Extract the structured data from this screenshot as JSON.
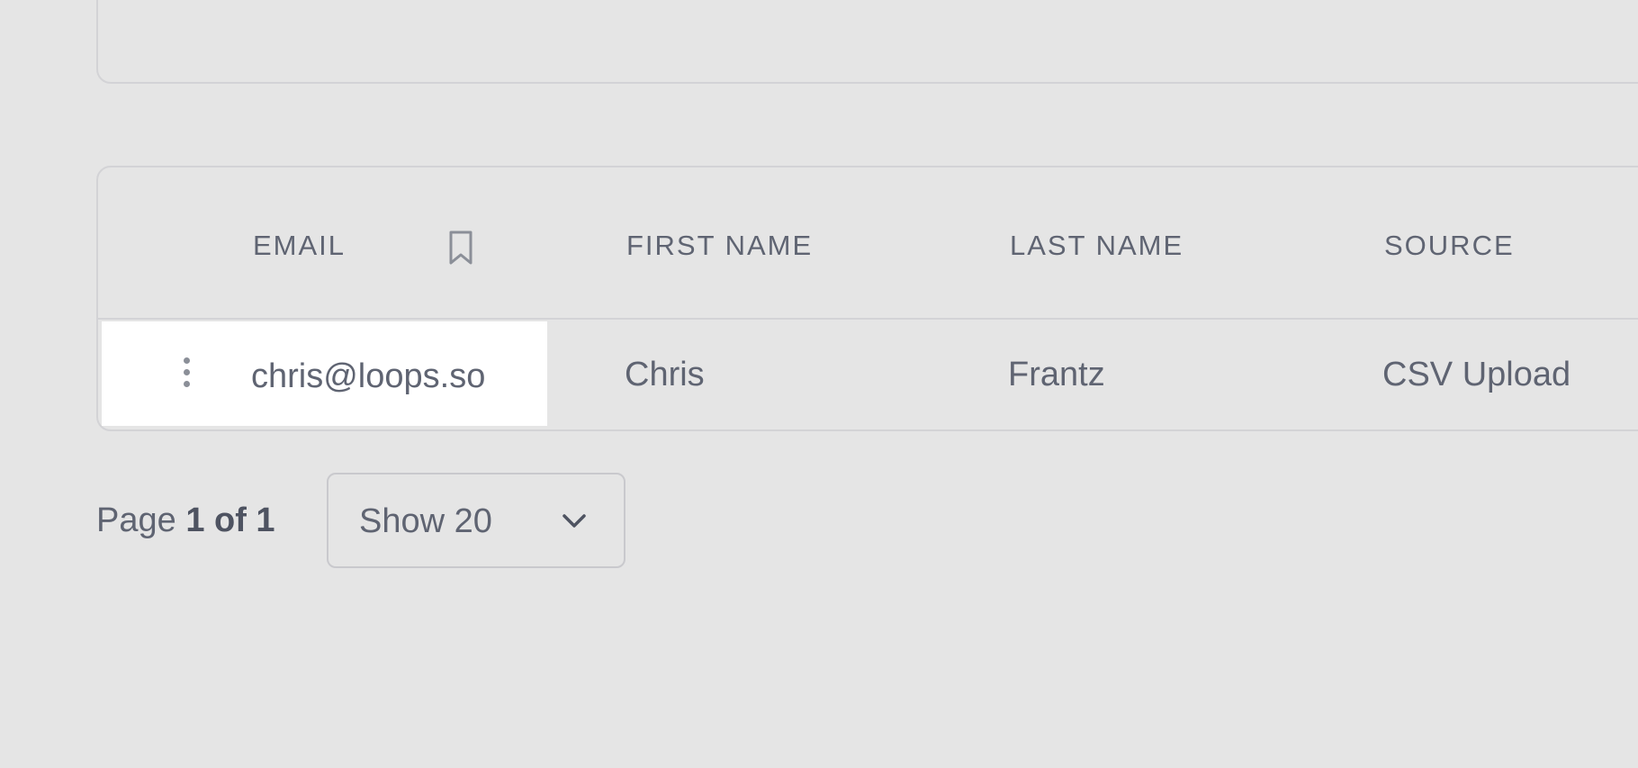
{
  "table": {
    "columns": [
      {
        "key": "email",
        "label": "EMAIL"
      },
      {
        "key": "first_name",
        "label": "FIRST NAME"
      },
      {
        "key": "last_name",
        "label": "LAST NAME"
      },
      {
        "key": "source",
        "label": "SOURCE"
      }
    ],
    "email_header_icon": "bookmark-icon",
    "rows": [
      {
        "row_menu_icon": "vertical-dots-icon",
        "email": "chris@loops.so",
        "first_name": "Chris",
        "last_name": "Frantz",
        "source": "CSV Upload"
      }
    ]
  },
  "pagination": {
    "page_prefix": "Page",
    "page_status": "1 of 1",
    "page_size_label": "Show 20",
    "page_size_icon": "chevron-down-icon"
  },
  "colors": {
    "background": "#e5e5e5",
    "card_border": "#d3d3d6",
    "sticky_cell_bg": "#ffffff",
    "text": "#5f6472"
  }
}
